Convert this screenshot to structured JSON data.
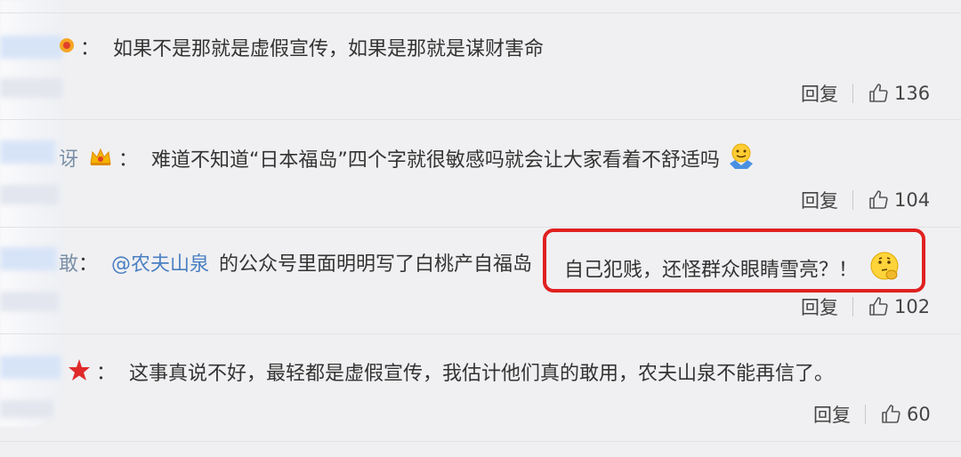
{
  "comments": [
    {
      "text": "如果不是那就是虚假宣传，如果是那就是谋财害命",
      "colon": "：",
      "reply_label": "回复",
      "likes": "136"
    },
    {
      "name_fragment": "讶",
      "colon": "：",
      "text": "难道不知道“日本福岛”四个字就很敏感吗就会让大家看着不舒适吗",
      "reply_label": "回复",
      "likes": "104"
    },
    {
      "name_fragment": "敢",
      "colon": "：",
      "mention": "@农夫山泉",
      "text_before_highlight": "的公众号里面明明写了白桃产自福岛",
      "highlight_text": "自己犯贱，还怪群众眼睛雪亮？！",
      "reply_label": "回复",
      "likes": "102"
    },
    {
      "colon": "：",
      "text": "这事真说不好，最轻都是虚假宣传，我估计他们真的敢用，农夫山泉不能再信了。",
      "reply_label": "回复",
      "likes": "60"
    }
  ],
  "colors": {
    "highlight_border": "#e02020",
    "mention": "#4a7fc1",
    "background": "#f0f0f2"
  },
  "icons": [
    "thumbs-up-icon",
    "crown-badge-icon",
    "star-badge-icon",
    "shrug-emoji-icon",
    "thinking-emoji-icon"
  ]
}
